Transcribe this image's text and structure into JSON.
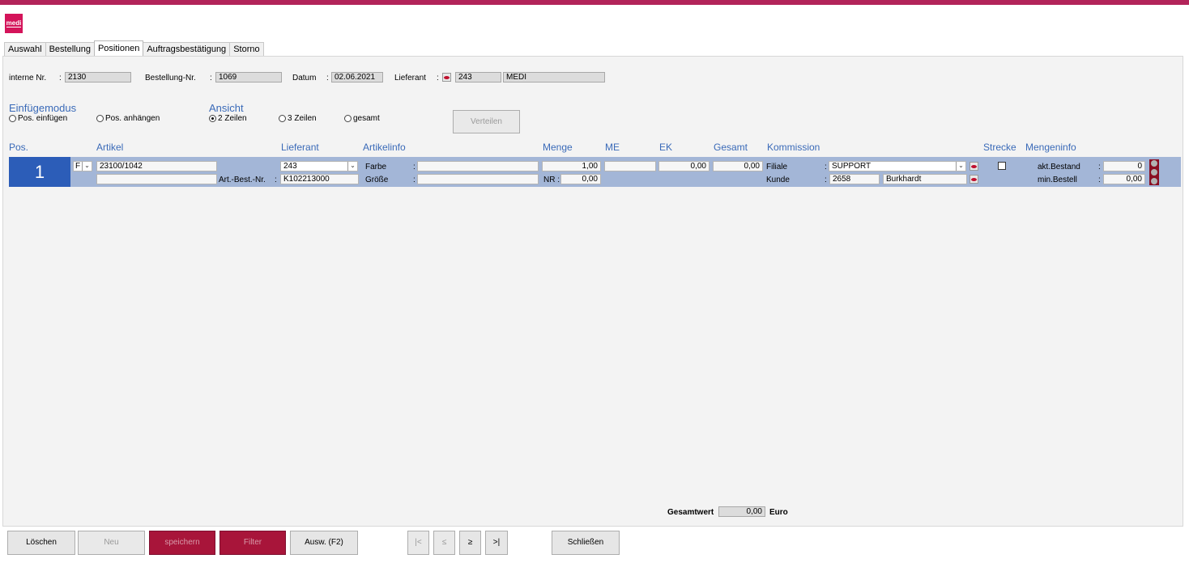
{
  "app": {
    "logo_text": "medi"
  },
  "tabs": [
    "Auswahl",
    "Bestellung",
    "Positionen",
    "Auftragsbestätigung",
    "Storno"
  ],
  "header": {
    "interne_nr_label": "interne Nr.",
    "interne_nr": "2130",
    "bestellung_nr_label": "Bestellung-Nr.",
    "bestellung_nr": "1069",
    "datum_label": "Datum",
    "datum": "02.06.2021",
    "lieferant_label": "Lieferant",
    "lieferant_nr": "243",
    "lieferant_name": "MEDI",
    "colon": ":"
  },
  "einfuegemodus": {
    "title": "Einfügemodus",
    "opt1": "Pos. einfügen",
    "opt2": "Pos. anhängen"
  },
  "ansicht": {
    "title": "Ansicht",
    "opt1": "2 Zeilen",
    "opt2": "3 Zeilen",
    "opt3": "gesamt",
    "selected": "2 Zeilen"
  },
  "verteilen_label": "Verteilen",
  "columns": {
    "pos": "Pos.",
    "artikel": "Artikel",
    "lieferant": "Lieferant",
    "artikelinfo": "Artikelinfo",
    "menge": "Menge",
    "me": "ME",
    "ek": "EK",
    "gesamt": "Gesamt",
    "kommission": "Kommission",
    "strecke": "Strecke",
    "mengeninfo": "Mengeninfo"
  },
  "position": {
    "nr": "1",
    "type": "F",
    "artikel": "23100/1042",
    "artikel2": "",
    "art_best_nr_label": "Art.-Best.-Nr.",
    "art_best_nr": "K102213000",
    "lieferant": "243",
    "farbe_label": "Farbe",
    "farbe": "",
    "groesse_label": "Größe",
    "groesse": "",
    "menge": "1,00",
    "nr_label": "NR :",
    "nr_value": "0,00",
    "me": "",
    "ek": "0,00",
    "gesamt": "0,00",
    "filiale_label": "Filiale",
    "filiale": "SUPPORT",
    "kunde_label": "Kunde",
    "kunde_nr": "2658",
    "kunde_name": "Burkhardt",
    "strecke_checked": false,
    "akt_bestand_label": "akt.Bestand",
    "akt_bestand": "0",
    "min_bestell_label": "min.Bestell",
    "min_bestell": "0,00"
  },
  "footer": {
    "gesamtwert_label": "Gesamtwert",
    "gesamtwert": "0,00",
    "currency": "Euro"
  },
  "buttons": {
    "loeschen": "Löschen",
    "neu": "Neu",
    "speichern": "speichern",
    "filter": "Filter",
    "ausw": "Ausw. (F2)",
    "first": "|<",
    "prev": "≤",
    "next": "≥",
    "last": ">|",
    "schliessen": "Schließen"
  },
  "colors": {
    "accent": "#b2245a",
    "blue_header": "#3a6ab8",
    "row_bg": "#a3b6d7",
    "pos_bg": "#2c5db8",
    "red_button": "#a8153a"
  }
}
